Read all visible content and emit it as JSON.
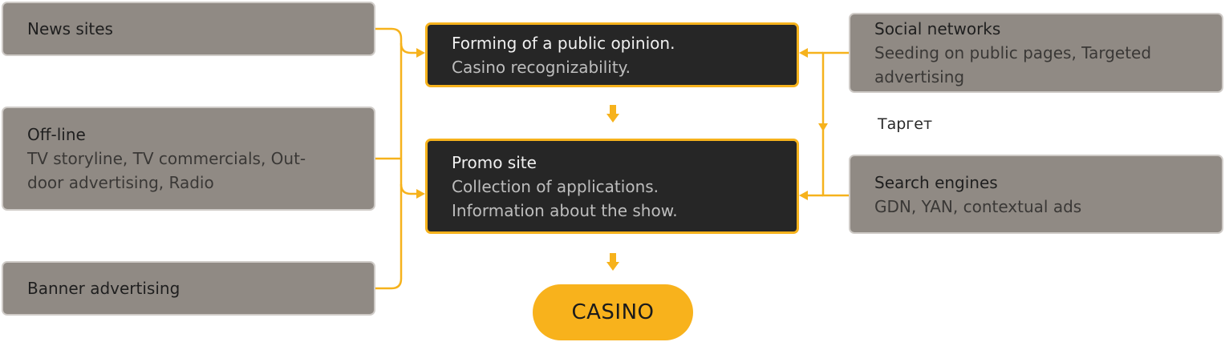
{
  "sources_left": [
    {
      "title": "News sites",
      "sub": ""
    },
    {
      "title": "Off-line",
      "sub": "TV storyline, TV commercials, Out-door advertising, Radio"
    },
    {
      "title": "Banner advertising",
      "sub": ""
    }
  ],
  "sources_right": [
    {
      "title": "Social networks",
      "sub": "Seeding on public pages, Targeted advertising"
    },
    {
      "title": "Search engines",
      "sub": "GDN, YAN, contextual ads"
    }
  ],
  "center": [
    {
      "title": "Forming of a public opinion.",
      "sub": "Casino recognizability."
    },
    {
      "title": "Promo site",
      "sub": "Collection of applications.",
      "sub2": "Information about the show."
    }
  ],
  "target_label": "Таргет",
  "casino_label": "CASINO",
  "colors": {
    "accent": "#f6b21c",
    "grey_box": "#908a84",
    "dark_box": "#262626"
  }
}
